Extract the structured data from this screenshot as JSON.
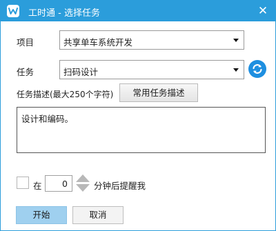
{
  "window": {
    "title": "工时通 - 选择任务",
    "close_glyph": "✕",
    "accent_color": "#2b9ddb"
  },
  "form": {
    "project_label": "项目",
    "project_value": "共享单车系统开发",
    "task_label": "任务",
    "task_value": "扫码设计",
    "refresh_icon": "refresh-icon",
    "desc_label": "任务描述(最大250个字符)",
    "common_desc_button": "常用任务描述",
    "desc_value": "设计和编码。"
  },
  "reminder": {
    "checked": false,
    "prefix_label": "在",
    "minutes_value": "0",
    "suffix_label": "分钟后提醒我"
  },
  "actions": {
    "start_label": "开始",
    "cancel_label": "取消"
  }
}
